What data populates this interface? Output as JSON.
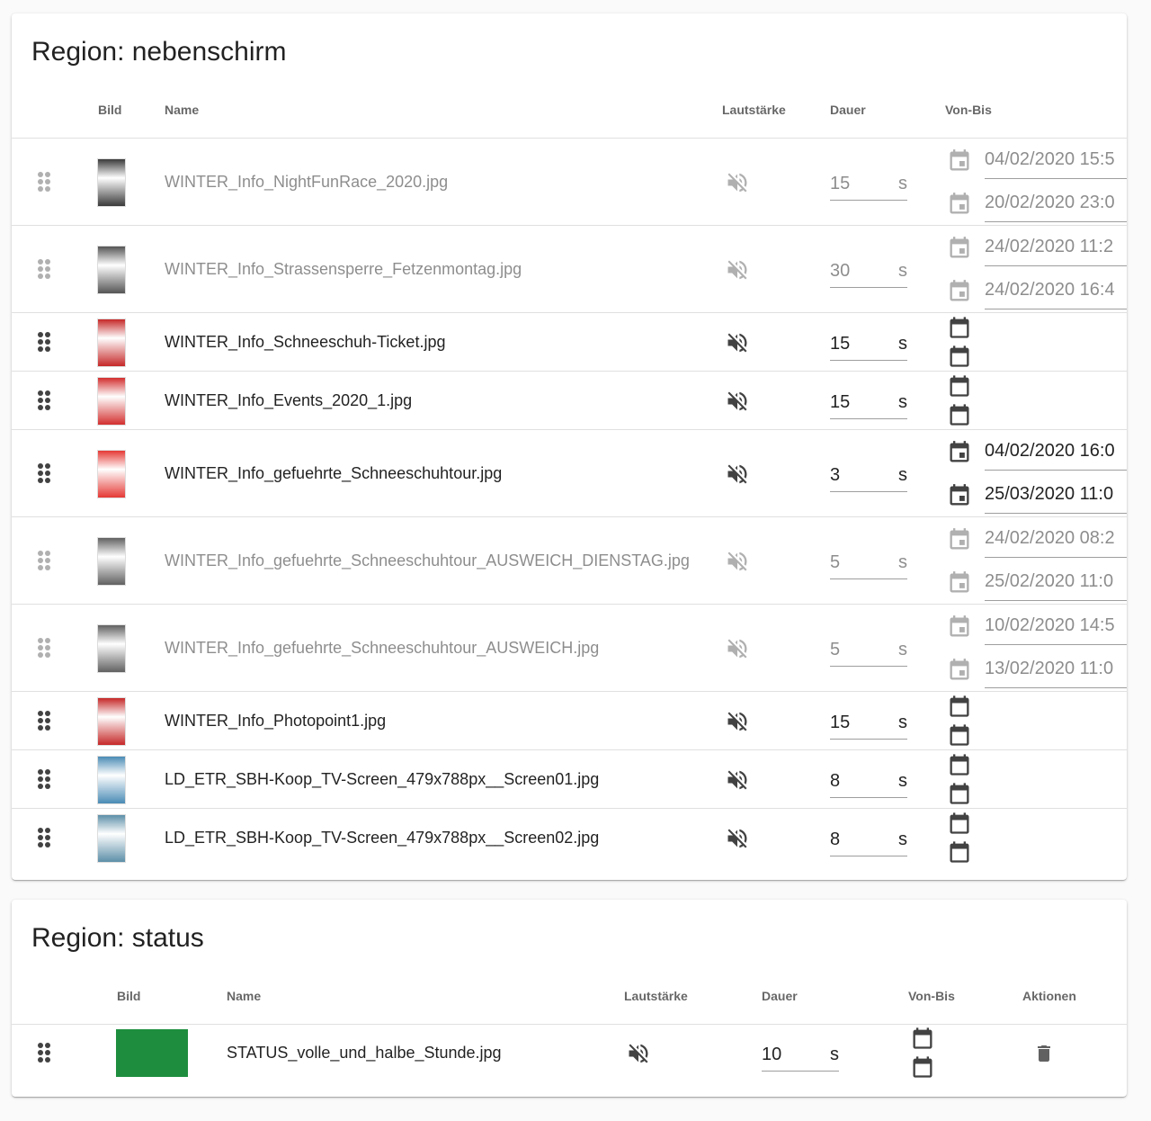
{
  "region1": {
    "title": "Region: nebenschirm",
    "columns": {
      "bild": "Bild",
      "name": "Name",
      "lautstaerke": "Lautstärke",
      "dauer": "Dauer",
      "vonbis": "Von-Bis"
    },
    "rows": [
      {
        "name": "WINTER_Info_NightFunRace_2020.jpg",
        "duration": "15",
        "unit": "s",
        "active": false,
        "from": "04/02/2020  15:5",
        "to": "20/02/2020  23:0",
        "thumb_color": "#3a3a3a"
      },
      {
        "name": "WINTER_Info_Strassensperre_Fetzenmontag.jpg",
        "duration": "30",
        "unit": "s",
        "active": false,
        "from": "24/02/2020  11:2",
        "to": "24/02/2020  16:4",
        "thumb_color": "#555555"
      },
      {
        "name": "WINTER_Info_Schneeschuh-Ticket.jpg",
        "duration": "15",
        "unit": "s",
        "active": true,
        "from": "",
        "to": "",
        "thumb_color": "#c62828"
      },
      {
        "name": "WINTER_Info_Events_2020_1.jpg",
        "duration": "15",
        "unit": "s",
        "active": true,
        "from": "",
        "to": "",
        "thumb_color": "#d32f2f"
      },
      {
        "name": "WINTER_Info_gefuehrte_Schneeschuhtour.jpg",
        "duration": "3",
        "unit": "s",
        "active": true,
        "from": "04/02/2020  16:0",
        "to": "25/03/2020  11:0",
        "thumb_color": "#e53935"
      },
      {
        "name": "WINTER_Info_gefuehrte_Schneeschuhtour_AUSWEICH_DIENSTAG.jpg",
        "duration": "5",
        "unit": "s",
        "active": false,
        "from": "24/02/2020  08:2",
        "to": "25/02/2020  11:0",
        "thumb_color": "#616161"
      },
      {
        "name": "WINTER_Info_gefuehrte_Schneeschuhtour_AUSWEICH.jpg",
        "duration": "5",
        "unit": "s",
        "active": false,
        "from": "10/02/2020  14:5",
        "to": "13/02/2020  11:0",
        "thumb_color": "#616161"
      },
      {
        "name": "WINTER_Info_Photopoint1.jpg",
        "duration": "15",
        "unit": "s",
        "active": true,
        "from": "",
        "to": "",
        "thumb_color": "#c62828"
      },
      {
        "name": "LD_ETR_SBH-Koop_TV-Screen_479x788px__Screen01.jpg",
        "duration": "8",
        "unit": "s",
        "active": true,
        "from": "",
        "to": "",
        "thumb_color": "#4a8bb5"
      },
      {
        "name": "LD_ETR_SBH-Koop_TV-Screen_479x788px__Screen02.jpg",
        "duration": "8",
        "unit": "s",
        "active": true,
        "from": "",
        "to": "",
        "thumb_color": "#5d8fa8"
      }
    ]
  },
  "region2": {
    "title": "Region: status",
    "columns": {
      "bild": "Bild",
      "name": "Name",
      "lautstaerke": "Lautstärke",
      "dauer": "Dauer",
      "vonbis": "Von-Bis",
      "aktionen": "Aktionen"
    },
    "rows": [
      {
        "name": "STATUS_volle_und_halbe_Stunde.jpg",
        "duration": "10",
        "unit": "s",
        "active": true,
        "thumb_color": "#1e8e3e"
      }
    ]
  },
  "icons": {
    "drag": "drag-handle-icon",
    "mute": "volume-off-icon",
    "calendar": "calendar-icon",
    "delete": "trash-icon"
  }
}
